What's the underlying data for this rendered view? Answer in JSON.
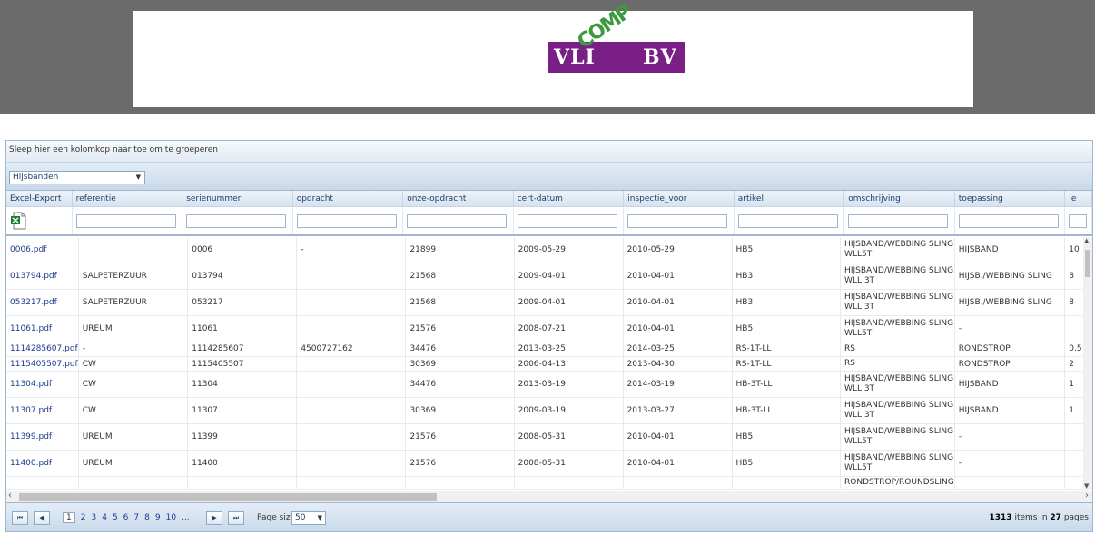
{
  "logo": {
    "left_text": "VLI",
    "middle_text": "COMP",
    "right_text": "BV"
  },
  "group_panel": {
    "text": "Sleep hier een kolomkop naar toe om te groeperen"
  },
  "toolbar": {
    "dropdown_value": "Hijsbanden"
  },
  "columns": [
    "Excel-Export",
    "referentie",
    "serienummer",
    "opdracht",
    "onze-opdracht",
    "cert-datum",
    "inspectie_voor",
    "artikel",
    "omschrijving",
    "toepassing",
    "le"
  ],
  "rows": [
    [
      "0006.pdf",
      "",
      "0006",
      "-",
      "21899",
      "2009-05-29",
      "2010-05-29",
      "HB5",
      "HIJSBAND/WEBBING SLING WLL5T",
      "HIJSBAND",
      "10"
    ],
    [
      "013794.pdf",
      "SALPETERZUUR",
      "013794",
      "",
      "21568",
      "2009-04-01",
      "2010-04-01",
      "HB3",
      "HIJSBAND/WEBBING SLING WLL 3T",
      "HIJSB./WEBBING SLING",
      "8"
    ],
    [
      "053217.pdf",
      "SALPETERZUUR",
      "053217",
      "",
      "21568",
      "2009-04-01",
      "2010-04-01",
      "HB3",
      "HIJSBAND/WEBBING SLING WLL 3T",
      "HIJSB./WEBBING SLING",
      "8"
    ],
    [
      "11061.pdf",
      "UREUM",
      "11061",
      "",
      "21576",
      "2008-07-21",
      "2010-04-01",
      "HB5",
      "HIJSBAND/WEBBING SLING WLL5T",
      "-",
      ""
    ],
    [
      "1114285607.pdf",
      "-",
      "1114285607",
      "4500727162",
      "34476",
      "2013-03-25",
      "2014-03-25",
      "RS-1T-LL",
      "RS",
      "RONDSTROP",
      "0.5"
    ],
    [
      "1115405507.pdf",
      "CW",
      "1115405507",
      "",
      "30369",
      "2006-04-13",
      "2013-04-30",
      "RS-1T-LL",
      "RS",
      "RONDSTROP",
      "2"
    ],
    [
      "11304.pdf",
      "CW",
      "11304",
      "",
      "34476",
      "2013-03-19",
      "2014-03-19",
      "HB-3T-LL",
      "HIJSBAND/WEBBING SLING WLL 3T",
      "HIJSBAND",
      "1"
    ],
    [
      "11307.pdf",
      "CW",
      "11307",
      "",
      "30369",
      "2009-03-19",
      "2013-03-27",
      "HB-3T-LL",
      "HIJSBAND/WEBBING SLING WLL 3T",
      "HIJSBAND",
      "1"
    ],
    [
      "11399.pdf",
      "UREUM",
      "11399",
      "",
      "21576",
      "2008-05-31",
      "2010-04-01",
      "HB5",
      "HIJSBAND/WEBBING SLING WLL5T",
      "-",
      ""
    ],
    [
      "11400.pdf",
      "UREUM",
      "11400",
      "",
      "21576",
      "2008-05-31",
      "2010-04-01",
      "HB5",
      "HIJSBAND/WEBBING SLING WLL5T",
      "-",
      ""
    ],
    [
      "",
      "",
      "",
      "",
      "",
      "",
      "",
      "",
      "RONDSTROP/ROUNDSLING",
      "",
      ""
    ]
  ],
  "pager": {
    "pages": [
      "1",
      "2",
      "3",
      "4",
      "5",
      "6",
      "7",
      "8",
      "9",
      "10",
      "..."
    ],
    "current_page": "1",
    "page_size_label": "Page size:",
    "page_size": "50",
    "total_items": "1313",
    "items_in_text": "items in",
    "total_pages": "27",
    "pages_text": "pages"
  },
  "colors": {
    "header_bg": "#d7e3ef",
    "link": "#1a3b8f",
    "banner": "#6b6b6b",
    "logo_purple": "#7a1f86",
    "logo_green": "#3b9a3b"
  }
}
